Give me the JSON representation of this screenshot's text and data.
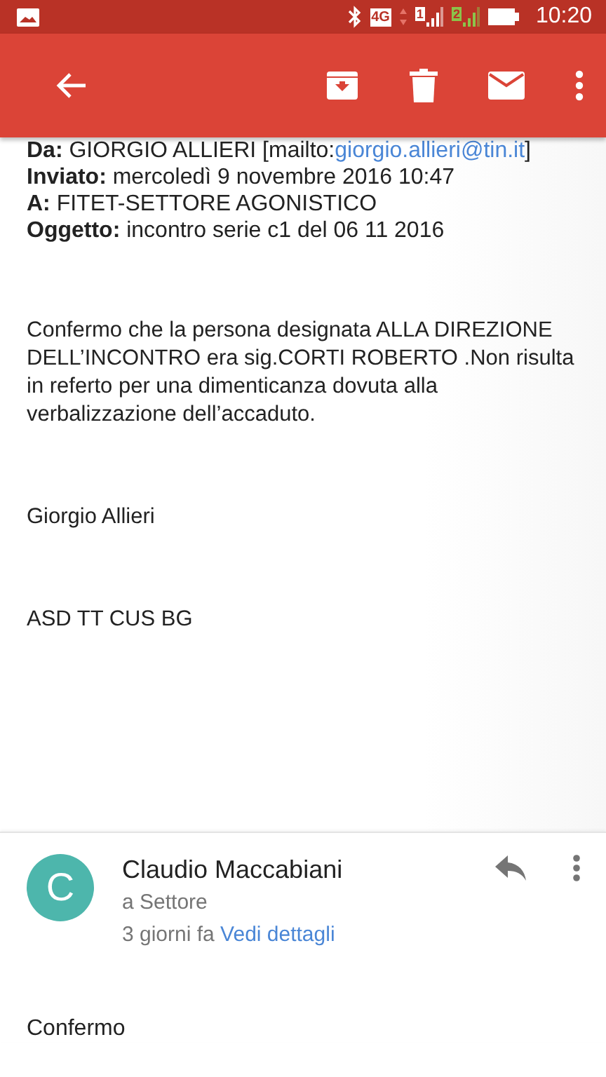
{
  "status_bar": {
    "network": "4G",
    "sim_1": "1",
    "sim_2": "2",
    "time": "10:20"
  },
  "quoted_header": [
    {
      "text": "**Da:** GIORGIO ALLIERI [mailto:",
      "link": "giorgio.allieri@tin.it",
      "after": "]"
    },
    {
      "text": "**Inviato:** mercoledì 9 novembre 2016 10:47"
    },
    {
      "text": "**A:** FITET-SETTORE AGONISTICO"
    },
    {
      "text": "**Oggetto:** incontro serie c1 del 06 11 2016"
    }
  ],
  "body": [
    "Confermo che la persona designata ALLA DIREZIONE DELL’INCONTRO era sig.CORTI ROBERTO .Non risulta in referto per una dimenticanza dovuta alla verbalizzazione dell’accaduto.",
    "Giorgio Allieri",
    "ASD TT CUS BG"
  ],
  "message": {
    "avatar_letter": "C",
    "sender": "Claudio Maccabiani",
    "recipient": "a Settore",
    "time": "3 giorni fa",
    "details_link": "Vedi dettagli",
    "body": "Confermo"
  }
}
